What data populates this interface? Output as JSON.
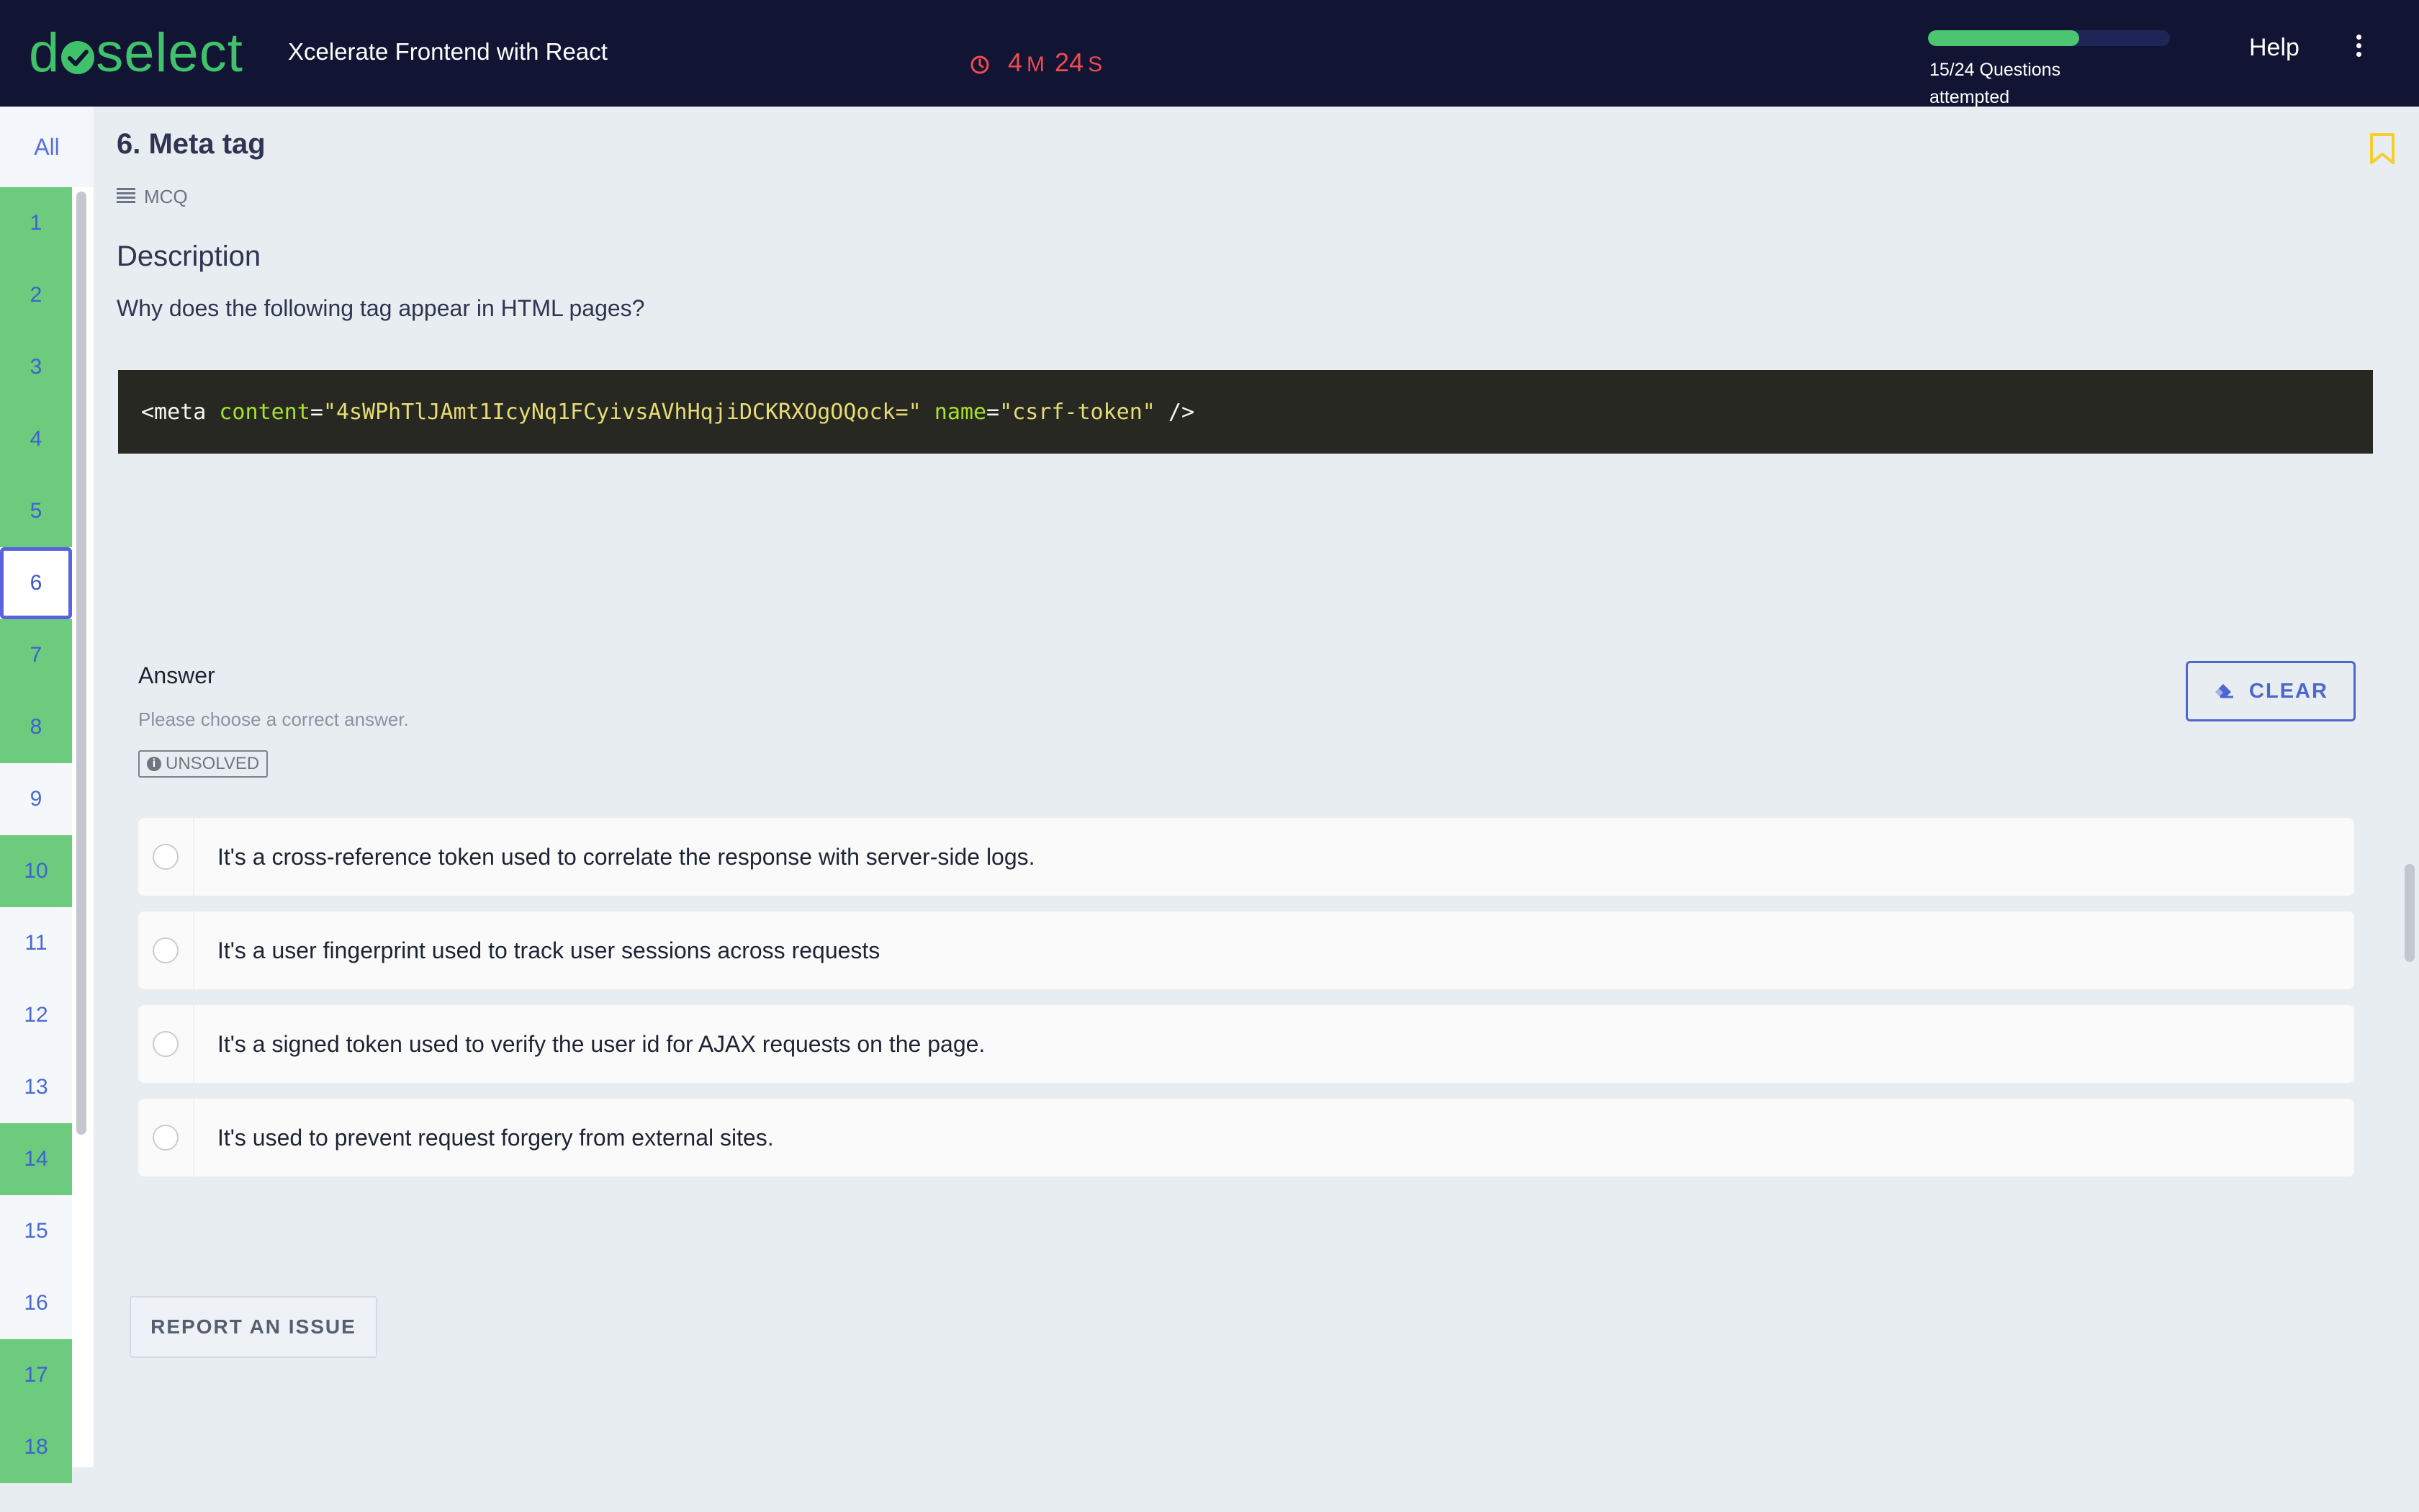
{
  "header": {
    "logo_text_start": "d",
    "logo_text_end": "select",
    "app_title": "Xcelerate Frontend with React",
    "timer": {
      "minutes": "4",
      "minutes_unit": "M",
      "seconds": "24",
      "seconds_unit": "S"
    },
    "progress": {
      "attempted": 15,
      "total": 24,
      "fraction": 0.625,
      "label": "15/24 Questions attempted"
    },
    "help_label": "Help"
  },
  "sidebar": {
    "all_label": "All",
    "items": [
      {
        "label": "1",
        "status": "done"
      },
      {
        "label": "2",
        "status": "done"
      },
      {
        "label": "3",
        "status": "done"
      },
      {
        "label": "4",
        "status": "done"
      },
      {
        "label": "5",
        "status": "done"
      },
      {
        "label": "6",
        "status": "current"
      },
      {
        "label": "7",
        "status": "done"
      },
      {
        "label": "8",
        "status": "done"
      },
      {
        "label": "9",
        "status": "todo"
      },
      {
        "label": "10",
        "status": "done"
      },
      {
        "label": "11",
        "status": "todo"
      },
      {
        "label": "12",
        "status": "todo"
      },
      {
        "label": "13",
        "status": "todo"
      },
      {
        "label": "14",
        "status": "done"
      },
      {
        "label": "15",
        "status": "todo"
      },
      {
        "label": "16",
        "status": "todo"
      },
      {
        "label": "17",
        "status": "done"
      },
      {
        "label": "18",
        "status": "done"
      }
    ]
  },
  "question": {
    "title": "6. Meta tag",
    "type": "MCQ",
    "description_heading": "Description",
    "description": "Why does the following tag appear in HTML pages?",
    "code": {
      "tag_open": "<meta ",
      "attr1": "content",
      "eq": "=",
      "val1": "\"4sWPhTlJAmt1IcyNq1FCyivsAVhHqjiDCKRXOgOQock=\"",
      "attr2": "name",
      "val2": "\"csrf-token\"",
      "tag_close": " />"
    }
  },
  "answer": {
    "label": "Answer",
    "hint": "Please choose a correct answer.",
    "status": "UNSOLVED",
    "clear_label": "CLEAR",
    "options": [
      "It's a cross-reference token used to correlate the response with server-side logs.",
      "It's a user fingerprint used to track user sessions across requests",
      "It's a signed token used to verify the user id for AJAX requests on the page.",
      "It's used to prevent request forgery from external sites."
    ]
  },
  "footer": {
    "report_label": "REPORT AN ISSUE"
  },
  "colors": {
    "topbar_bg": "#111533",
    "brand_green": "#3fc26a",
    "timer_red": "#ef4b4f",
    "accent_blue": "#4c67cf",
    "done_green": "#6ccb7d",
    "bookmark_yellow": "#f5cd2c"
  }
}
